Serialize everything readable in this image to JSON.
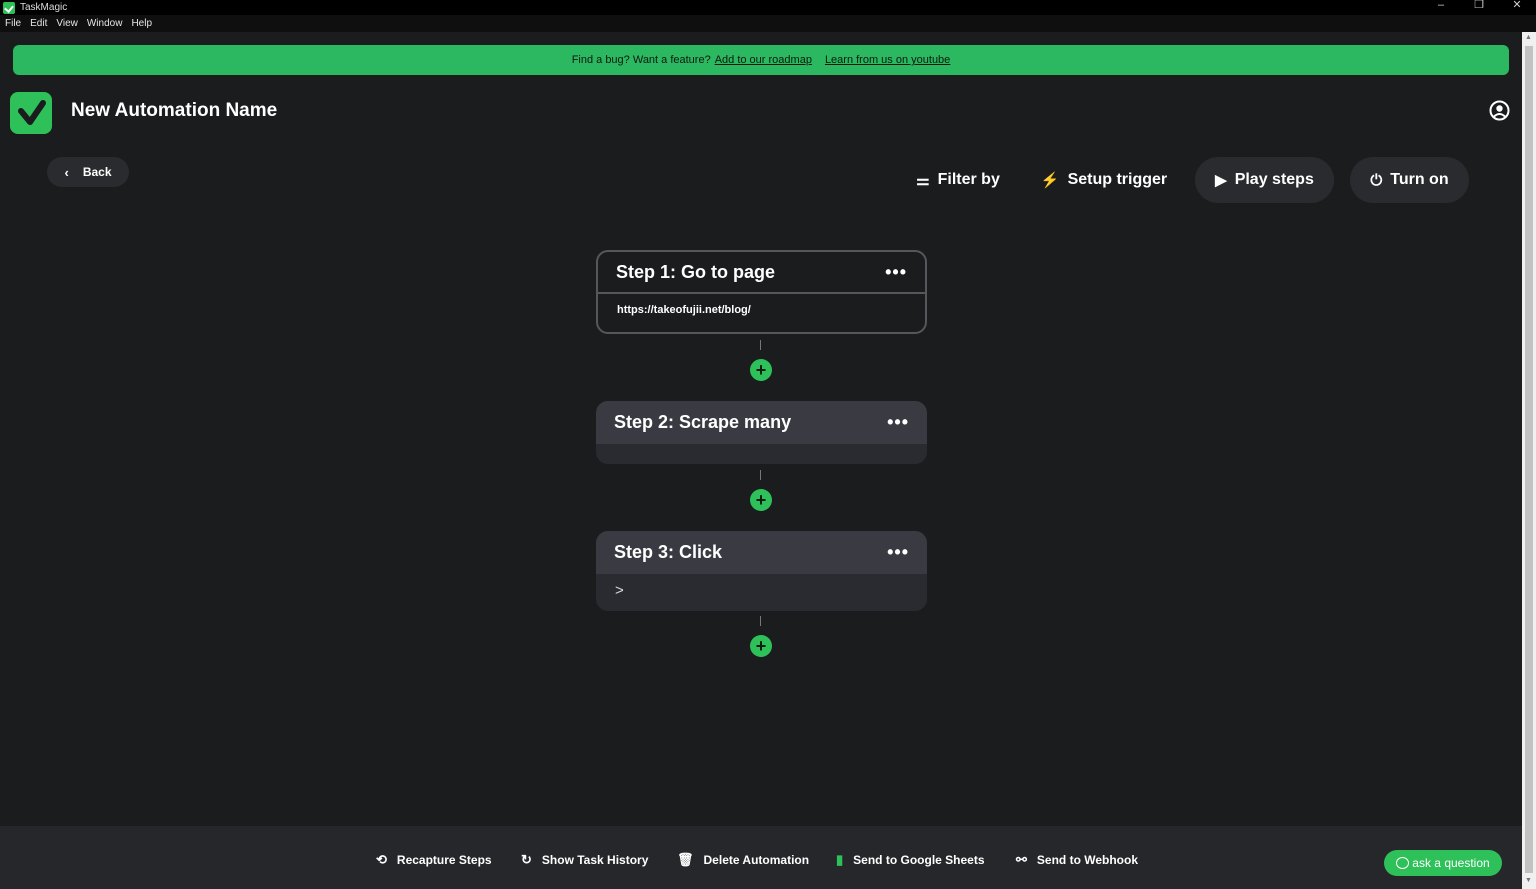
{
  "window": {
    "title": "TaskMagic",
    "controls": {
      "minimize": "–",
      "restore": "❐",
      "close": "✕"
    }
  },
  "menu": [
    "File",
    "Edit",
    "View",
    "Window",
    "Help"
  ],
  "banner": {
    "text": "Find a bug? Want a feature?",
    "link_roadmap": "Add to our roadmap",
    "link_youtube": "Learn from us on youtube",
    "color": "#2cb860"
  },
  "header": {
    "automation_name": "New Automation Name"
  },
  "toolbar": {
    "back_label": "Back",
    "filter_label": "Filter by",
    "trigger_label": "Setup trigger",
    "play_label": "Play steps",
    "turnon_label": "Turn on"
  },
  "steps": [
    {
      "title": "Step 1: Go to page",
      "menu": "•••",
      "detail": "https://takeofujii.net/blog/"
    },
    {
      "title": "Step 2: Scrape many",
      "menu": "•••",
      "detail": ""
    },
    {
      "title": "Step 3: Click",
      "menu": "•••",
      "detail": ">"
    }
  ],
  "add_step_symbol": "+",
  "bottom_actions": {
    "recapture": "Recapture Steps",
    "history": "Show Task History",
    "delete": "Delete Automation",
    "sheets": "Send to Google Sheets",
    "webhook": "Send to Webhook"
  },
  "ask_label": "ask a question",
  "accent_color": "#2ec15a"
}
